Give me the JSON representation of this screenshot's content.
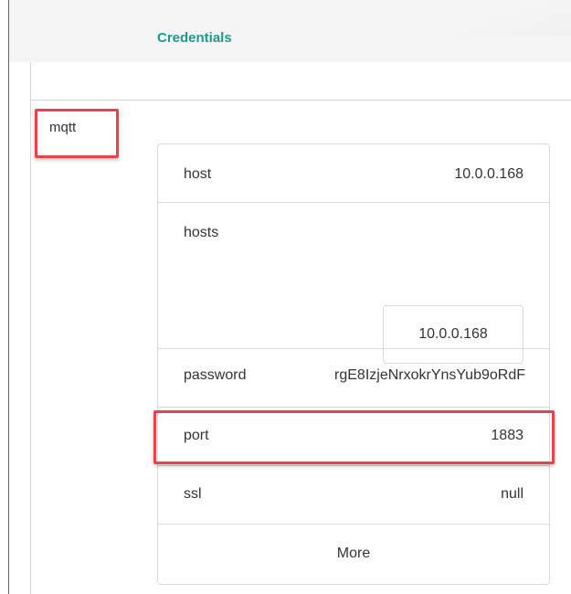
{
  "header": {
    "title": "Credentials"
  },
  "service": {
    "name": "mqtt"
  },
  "credentials": {
    "host": {
      "key": "host",
      "value": "10.0.0.168"
    },
    "hosts": {
      "key": "hosts",
      "items": [
        "10.0.0.168"
      ]
    },
    "password": {
      "key": "password",
      "value": "rgE8IzjeNrxokrYnsYub9oRdF"
    },
    "port": {
      "key": "port",
      "value": "1883"
    },
    "ssl": {
      "key": "ssl",
      "value": "null"
    }
  },
  "actions": {
    "more_label": "More"
  },
  "colors": {
    "accent": "#1a9a8e",
    "highlight": "#e8434b",
    "border": "#d9d9d9"
  }
}
